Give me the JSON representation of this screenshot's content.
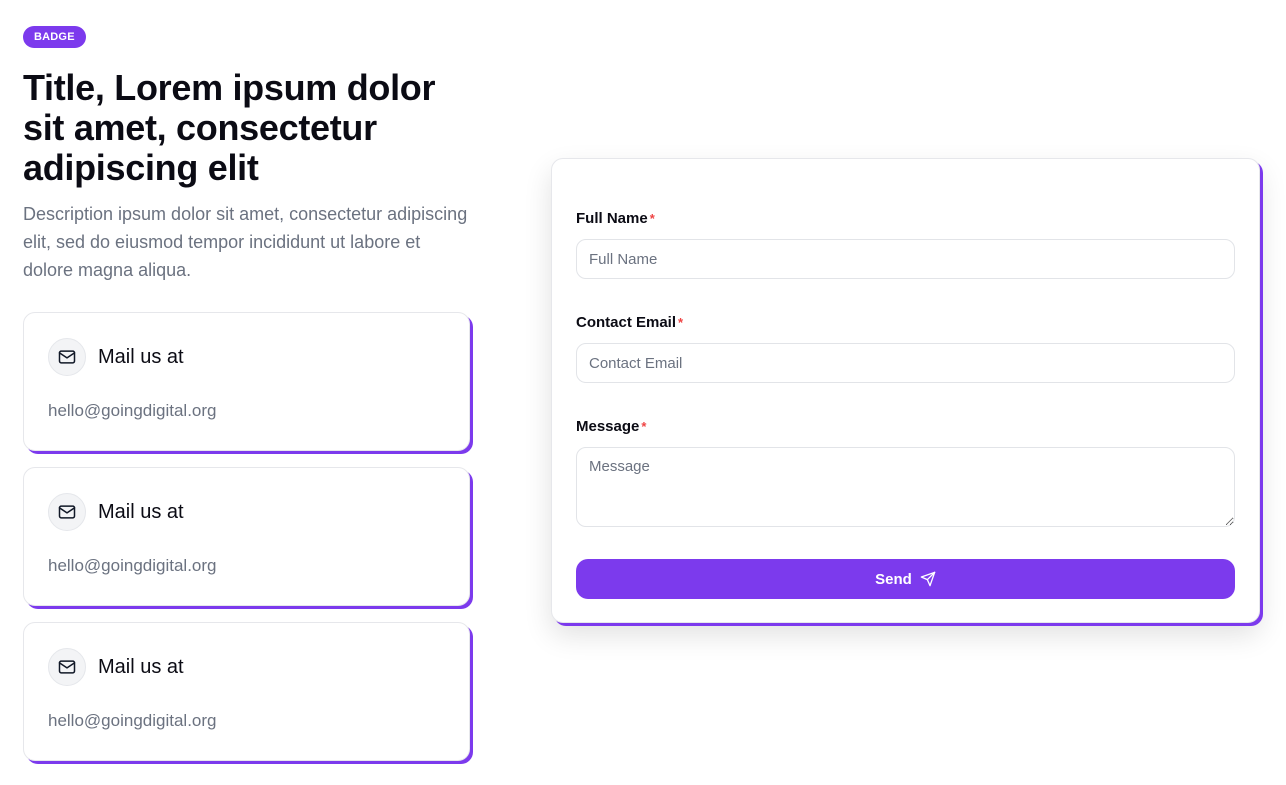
{
  "hero": {
    "badge": "BADGE",
    "title": "Title, Lorem ipsum dolor sit amet, consectetur adipiscing elit",
    "description": "Description ipsum dolor sit amet, consectetur adipiscing elit, sed do eiusmod tempor incididunt ut labore et dolore magna aliqua."
  },
  "contact_cards": [
    {
      "icon": "mail-icon",
      "title": "Mail us at",
      "email": "hello@goingdigital.org"
    },
    {
      "icon": "mail-icon",
      "title": "Mail us at",
      "email": "hello@goingdigital.org"
    },
    {
      "icon": "mail-icon",
      "title": "Mail us at",
      "email": "hello@goingdigital.org"
    }
  ],
  "form": {
    "full_name": {
      "label": "Full Name",
      "required_mark": "*",
      "placeholder": "Full Name"
    },
    "email": {
      "label": "Contact Email",
      "required_mark": "*",
      "placeholder": "Contact Email"
    },
    "message": {
      "label": "Message",
      "required_mark": "*",
      "placeholder": "Message"
    },
    "submit_label": "Send",
    "submit_icon": "send-icon"
  },
  "colors": {
    "accent": "#7c3aed",
    "required": "#ef4444",
    "muted_text": "#6b7280"
  }
}
